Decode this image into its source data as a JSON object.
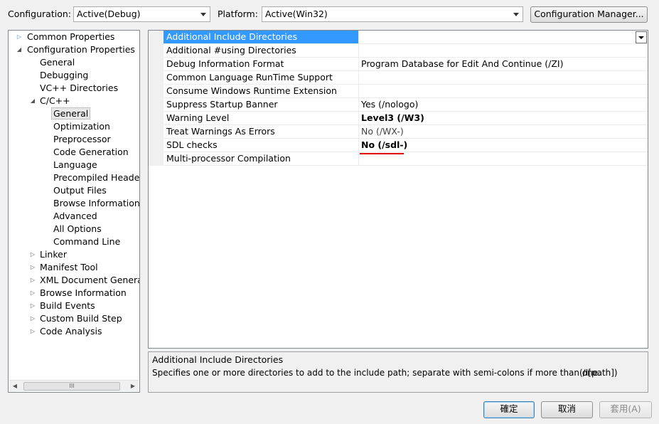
{
  "header": {
    "configuration_label": "Configuration:",
    "configuration_value": "Active(Debug)",
    "platform_label": "Platform:",
    "platform_value": "Active(Win32)",
    "config_manager_button": "Configuration Manager..."
  },
  "tree": {
    "root_common": "Common Properties",
    "root_config": "Configuration Properties",
    "general": "General",
    "debugging": "Debugging",
    "vc_dirs": "VC++ Directories",
    "cpp": "C/C++",
    "cpp_children": [
      "General",
      "Optimization",
      "Preprocessor",
      "Code Generation",
      "Language",
      "Precompiled Headers",
      "Output Files",
      "Browse Information",
      "Advanced",
      "All Options",
      "Command Line"
    ],
    "collapsed": [
      "Linker",
      "Manifest Tool",
      "XML Document Generator",
      "Browse Information",
      "Build Events",
      "Custom Build Step",
      "Code Analysis"
    ],
    "scroll_thumb": "III"
  },
  "properties": [
    {
      "name": "Additional Include Directories",
      "value": ""
    },
    {
      "name": "Additional #using Directories",
      "value": ""
    },
    {
      "name": "Debug Information Format",
      "value": "Program Database for Edit And Continue (/ZI)"
    },
    {
      "name": "Common Language RunTime Support",
      "value": ""
    },
    {
      "name": "Consume Windows Runtime Extension",
      "value": ""
    },
    {
      "name": "Suppress Startup Banner",
      "value": "Yes (/nologo)"
    },
    {
      "name": "Warning Level",
      "value": "Level3 (/W3)"
    },
    {
      "name": "Treat Warnings As Errors",
      "value": "No (/WX-)"
    },
    {
      "name": "SDL checks",
      "value": "No (/sdl-)"
    },
    {
      "name": "Multi-processor Compilation",
      "value": ""
    }
  ],
  "description": {
    "title": "Additional Include Directories",
    "body": "Specifies one or more directories to add to the include path; separate with semi-colons if more than one.",
    "switch": "(/I[path])"
  },
  "footer": {
    "ok": "確定",
    "cancel": "取消",
    "apply": "套用(A)"
  },
  "colors": {
    "selection": "#3399ff",
    "annotation_underline": "#e00000"
  }
}
